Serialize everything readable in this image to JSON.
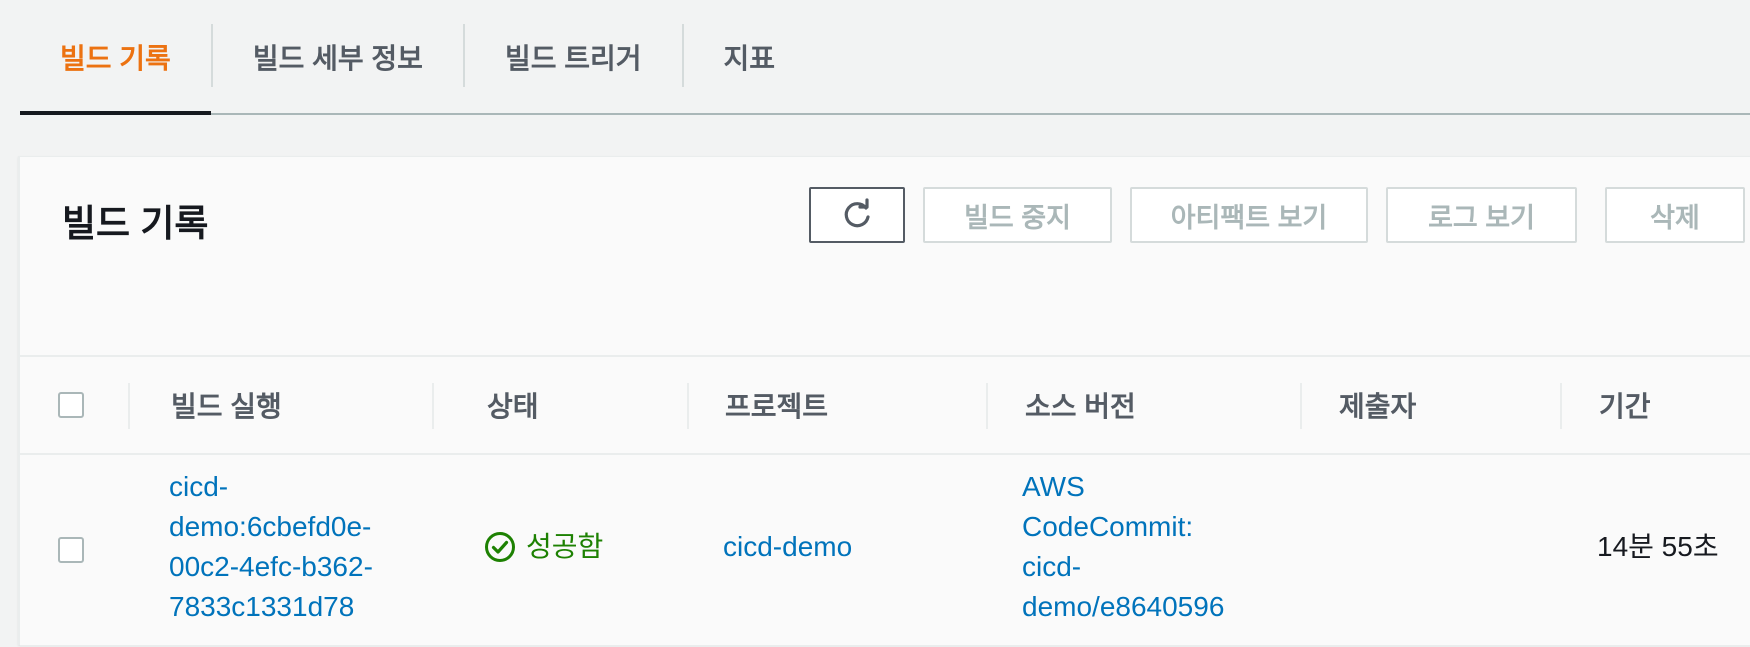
{
  "tabs": [
    {
      "label": "빌드 기록",
      "active": true
    },
    {
      "label": "빌드 세부 정보",
      "active": false
    },
    {
      "label": "빌드 트리거",
      "active": false
    },
    {
      "label": "지표",
      "active": false
    }
  ],
  "panel": {
    "title": "빌드 기록",
    "buttons": {
      "refresh_icon": "refresh-icon",
      "stop": "빌드 중지",
      "artifacts": "아티팩트 보기",
      "logs": "로그 보기",
      "delete": "삭제"
    }
  },
  "table": {
    "columns": [
      "빌드 실행",
      "상태",
      "프로젝트",
      "소스 버전",
      "제출자",
      "기간"
    ],
    "rows": [
      {
        "build_run": [
          "cicd-",
          "demo:6cbefd0e-",
          "00c2-4efc-b362-",
          "7833c1331d78"
        ],
        "status": "성공함",
        "project": "cicd-demo",
        "source_version": [
          "AWS",
          "CodeCommit:",
          "cicd-",
          "demo/e8640596"
        ],
        "submitter": "",
        "duration": "14분 55초"
      }
    ]
  },
  "colors": {
    "active_tab": "#ec7211",
    "link": "#0073bb",
    "success": "#1d8102"
  }
}
